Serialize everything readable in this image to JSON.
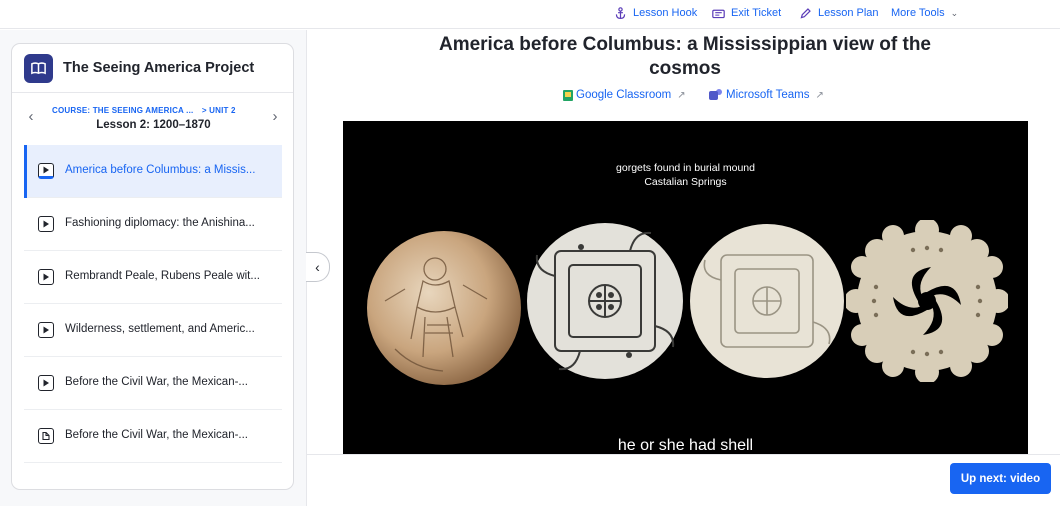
{
  "toolbar": {
    "lesson_hook": "Lesson Hook",
    "exit_ticket": "Exit Ticket",
    "lesson_plan": "Lesson Plan",
    "more_tools": "More Tools",
    "icons": [
      "anchor-icon",
      "ticket-icon",
      "pencil-icon",
      "chevron-down-icon"
    ],
    "accent_color": "#1865f2"
  },
  "sidebar": {
    "title": "The Seeing America Project",
    "logo_icon": "book-icon",
    "breadcrumb": {
      "course": "COURSE: THE SEEING AMERICA ...",
      "separator": ">",
      "unit": "UNIT 2"
    },
    "lesson_name": "Lesson 2: 1200–1870",
    "items": [
      {
        "label": "America before Columbus: a Missis...",
        "type": "video",
        "active": true
      },
      {
        "label": "Fashioning diplomacy: the Anishina...",
        "type": "video",
        "active": false
      },
      {
        "label": "Rembrandt Peale, Rubens Peale wit...",
        "type": "video",
        "active": false
      },
      {
        "label": "Wilderness, settlement, and Americ...",
        "type": "video",
        "active": false
      },
      {
        "label": "Before the Civil War, the Mexican-...",
        "type": "video",
        "active": false
      },
      {
        "label": "Before the Civil War, the Mexican-...",
        "type": "article",
        "active": false
      }
    ]
  },
  "main": {
    "title": "America before Columbus: a Mississippian view of the cosmos",
    "share": {
      "google_classroom": "Google Classroom",
      "microsoft_teams": "Microsoft Teams"
    },
    "video": {
      "caption_line1": "gorgets found in burial mound",
      "caption_line2": "Castalian Springs",
      "subtitle": "he or she had shell"
    },
    "up_next": "Up next: video"
  }
}
